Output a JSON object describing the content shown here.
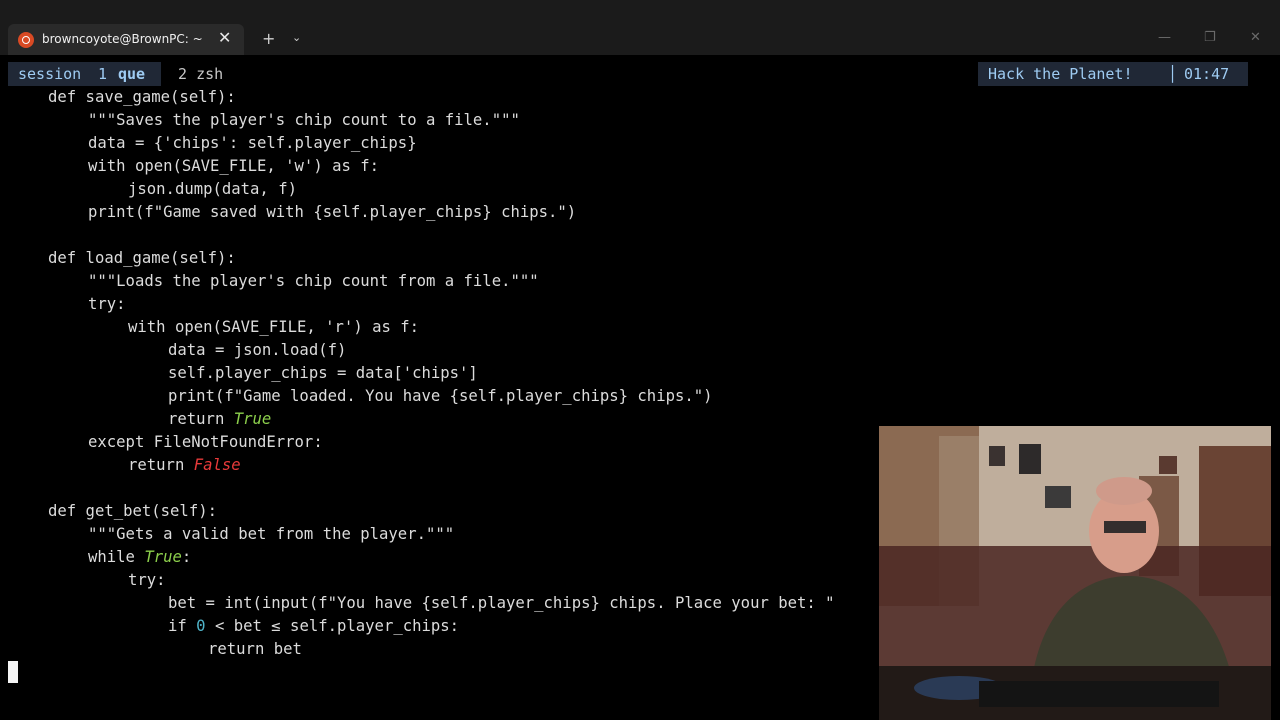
{
  "window": {
    "tab_title": "browncoyote@BrownPC: ~",
    "close_glyph": "✕",
    "new_tab_glyph": "+",
    "dropdown_glyph": "⌄",
    "minimize_glyph": "—",
    "maximize_glyph": "❐",
    "window_close_glyph": "✕"
  },
  "tmux": {
    "session_label": "session",
    "session_index": "1",
    "session_name": "que",
    "window2_index": "2",
    "window2_name": "zsh",
    "status_text": "Hack the Planet!",
    "separator": "│",
    "clock": "01:47"
  },
  "code_lines": [
    {
      "indent": 4,
      "text": "def save_game(self):"
    },
    {
      "indent": 8,
      "text": "\"\"\"Saves the player's chip count to a file.\"\"\""
    },
    {
      "indent": 8,
      "text": "data = {'chips': self.player_chips}"
    },
    {
      "indent": 8,
      "text": "with open(SAVE_FILE, 'w') as f:"
    },
    {
      "indent": 12,
      "text": "json.dump(data, f)"
    },
    {
      "indent": 8,
      "text": "print(f\"Game saved with {self.player_chips} chips.\")"
    },
    {
      "indent": 0,
      "text": ""
    },
    {
      "indent": 4,
      "text": "def load_game(self):"
    },
    {
      "indent": 8,
      "text": "\"\"\"Loads the player's chip count from a file.\"\"\""
    },
    {
      "indent": 8,
      "text": "try:"
    },
    {
      "indent": 12,
      "text": "with open(SAVE_FILE, 'r') as f:"
    },
    {
      "indent": 16,
      "text": "data = json.load(f)"
    },
    {
      "indent": 16,
      "text": "self.player_chips = data['chips']"
    },
    {
      "indent": 16,
      "text": "print(f\"Game loaded. You have {self.player_chips} chips.\")"
    },
    {
      "indent": 16,
      "text": "return ",
      "hl": "True",
      "hl_class": "kw-true"
    },
    {
      "indent": 8,
      "text": "except FileNotFoundError:"
    },
    {
      "indent": 12,
      "text": "return ",
      "hl": "False",
      "hl_class": "kw-false"
    },
    {
      "indent": 0,
      "text": ""
    },
    {
      "indent": 4,
      "text": "def get_bet(self):"
    },
    {
      "indent": 8,
      "text": "\"\"\"Gets a valid bet from the player.\"\"\""
    },
    {
      "indent": 8,
      "text": "while ",
      "hl": "True",
      "hl_class": "kw-true",
      "after": ":"
    },
    {
      "indent": 12,
      "text": "try:"
    },
    {
      "indent": 16,
      "text": "bet = int(input(f\"You have {self.player_chips} chips. Place your bet: \""
    },
    {
      "indent": 16,
      "text": "if ",
      "hl": "0",
      "hl_class": "num",
      "after": " < bet ≤ self.player_chips:"
    },
    {
      "indent": 20,
      "text": "return bet"
    }
  ],
  "colors": {
    "keyword_true": "#8ccf4c",
    "keyword_false": "#e83a3a",
    "number": "#4fb3c8",
    "tmux_status_bg": "#202836",
    "tmux_status_fg": "#9ecbf2"
  }
}
